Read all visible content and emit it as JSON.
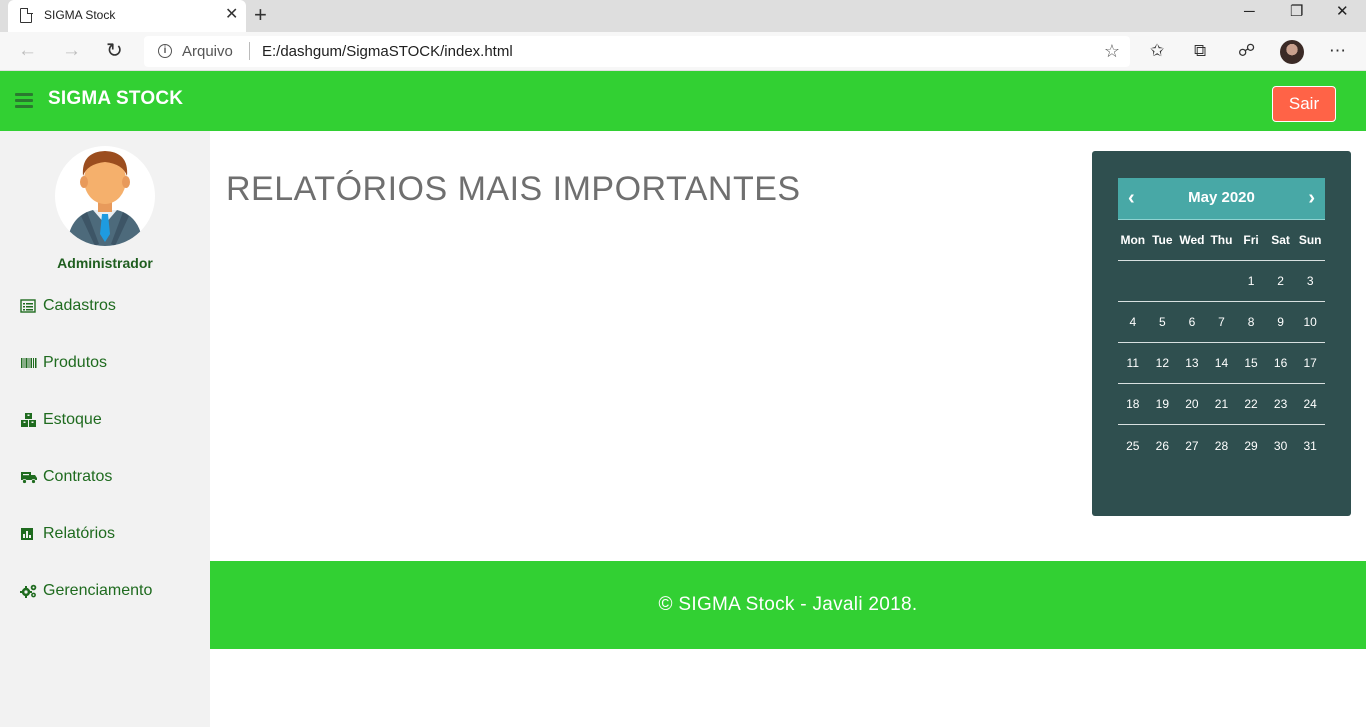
{
  "browser": {
    "tab_title": "SIGMA Stock",
    "url_protocol_label": "Arquivo",
    "url": "E:/dashgum/SigmaSTOCK/index.html"
  },
  "header": {
    "brand": "SIGMA STOCK",
    "logout_label": "Sair",
    "accent_color": "#32d033",
    "logout_color": "#ff6347"
  },
  "sidebar": {
    "user_name": "Administrador",
    "items": [
      {
        "label": "Cadastros",
        "icon": "list-icon"
      },
      {
        "label": "Produtos",
        "icon": "barcode-icon"
      },
      {
        "label": "Estoque",
        "icon": "boxes-icon"
      },
      {
        "label": "Contratos",
        "icon": "truck-icon"
      },
      {
        "label": "Relatórios",
        "icon": "bar-chart-icon"
      },
      {
        "label": "Gerenciamento",
        "icon": "cogs-icon"
      }
    ]
  },
  "main": {
    "title": "RELATÓRIOS MAIS IMPORTANTES"
  },
  "calendar": {
    "month_label": "May 2020",
    "weekdays": [
      "Mon",
      "Tue",
      "Wed",
      "Thu",
      "Fri",
      "Sat",
      "Sun"
    ],
    "weeks": [
      [
        "",
        "",
        "",
        "",
        "1",
        "2",
        "3"
      ],
      [
        "4",
        "5",
        "6",
        "7",
        "8",
        "9",
        "10"
      ],
      [
        "11",
        "12",
        "13",
        "14",
        "15",
        "16",
        "17"
      ],
      [
        "18",
        "19",
        "20",
        "21",
        "22",
        "23",
        "24"
      ],
      [
        "25",
        "26",
        "27",
        "28",
        "29",
        "30",
        "31"
      ]
    ]
  },
  "footer": {
    "text": "© SIGMA Stock - Javali 2018."
  }
}
